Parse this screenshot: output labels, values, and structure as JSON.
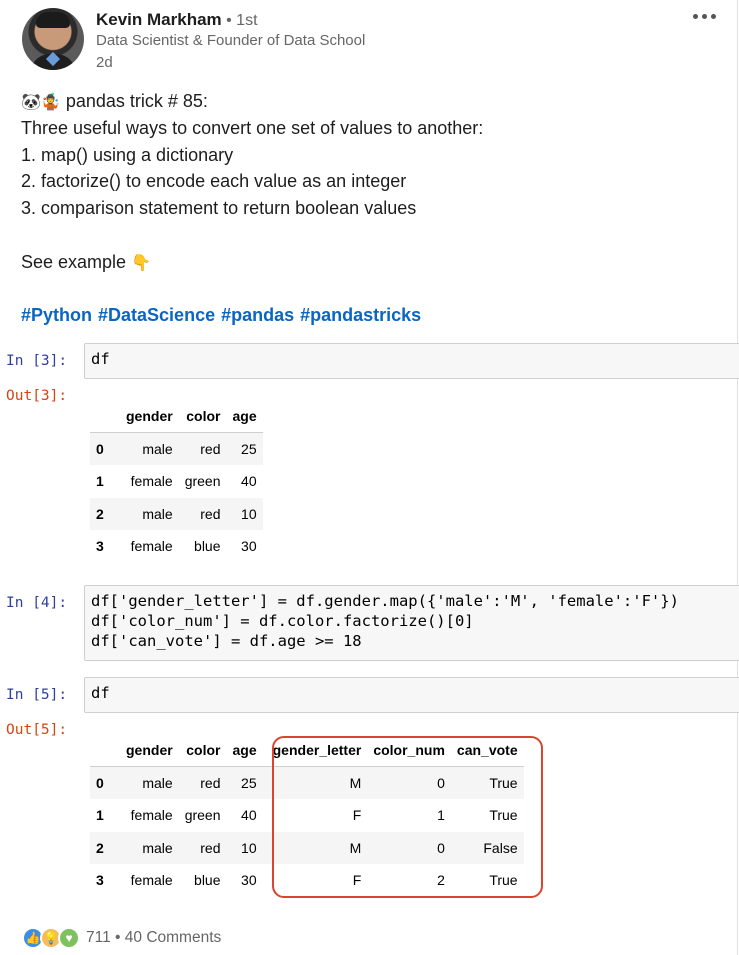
{
  "post": {
    "author_name": "Kevin Markham",
    "degree": " • 1st",
    "headline": "Data Scientist & Founder of Data School",
    "time": "2d",
    "emoji_prefix": "🐼🤹",
    "lines": [
      " pandas trick # 85:",
      "Three useful ways to convert one set of values to another:",
      "1. map() using a dictionary",
      "2. factorize() to encode each value as an integer",
      "3. comparison statement to return boolean values"
    ],
    "see_example": "See example ",
    "see_example_emoji": "👇",
    "hashtags": [
      "#Python",
      "#DataScience",
      "#pandas",
      "#pandastricks"
    ]
  },
  "notebook": {
    "cell3": {
      "in_prompt": "In [3]:",
      "code": "df",
      "out_prompt": "Out[3]:"
    },
    "cell4": {
      "in_prompt": "In [4]:",
      "lines": [
        "df['gender_letter'] = df.gender.map({'male':'M', 'female':'F'})",
        "df['color_num'] = df.color.factorize()[0]",
        "df['can_vote'] = df.age >= 18"
      ]
    },
    "cell5": {
      "in_prompt": "In [5]:",
      "code": "df",
      "out_prompt": "Out[5]:"
    },
    "table1": {
      "columns": [
        "",
        "gender",
        "color",
        "age"
      ],
      "rows": [
        [
          "0",
          "male",
          "red",
          "25"
        ],
        [
          "1",
          "female",
          "green",
          "40"
        ],
        [
          "2",
          "male",
          "red",
          "10"
        ],
        [
          "3",
          "female",
          "blue",
          "30"
        ]
      ]
    },
    "table2": {
      "columns": [
        "",
        "gender",
        "color",
        "age",
        "gender_letter",
        "color_num",
        "can_vote"
      ],
      "rows": [
        [
          "0",
          "male",
          "red",
          "25",
          "M",
          "0",
          "True"
        ],
        [
          "1",
          "female",
          "green",
          "40",
          "F",
          "1",
          "True"
        ],
        [
          "2",
          "male",
          "red",
          "10",
          "M",
          "0",
          "False"
        ],
        [
          "3",
          "female",
          "blue",
          "30",
          "F",
          "2",
          "True"
        ]
      ]
    }
  },
  "reactions": {
    "icons": [
      "like-icon",
      "insightful-icon",
      "support-icon"
    ],
    "count": "711",
    "separator": " • ",
    "comments": "40 Comments"
  },
  "colors": {
    "hashtag": "#0a66c2",
    "in_prompt": "#303f9f",
    "out_prompt": "#d84315",
    "highlight": "#d9452f"
  }
}
